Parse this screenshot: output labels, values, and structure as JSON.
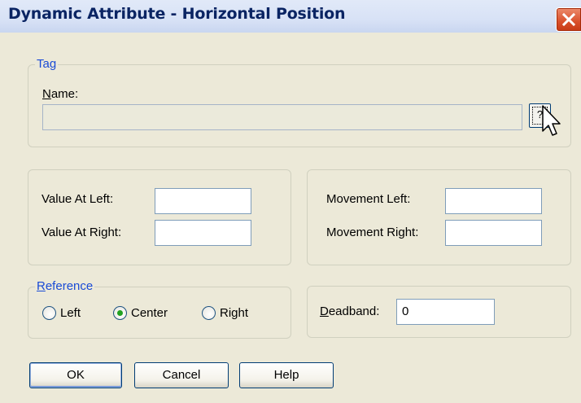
{
  "window": {
    "title": "Dynamic Attribute - Horizontal Position",
    "close_icon": "close-icon"
  },
  "tag": {
    "legend": "Tag",
    "name_label": "Name:",
    "name_value": "",
    "browse_label": "?",
    "cursor_icon": "mouse-pointer-icon"
  },
  "values": {
    "value_at_left_label": "Value At Left:",
    "value_at_left": "",
    "value_at_right_label": "Value At Right:",
    "value_at_right": ""
  },
  "movement": {
    "left_label": "Movement Left:",
    "left_value": "",
    "right_label": "Movement Right:",
    "right_value": ""
  },
  "reference": {
    "legend": "Reference",
    "options": [
      "Left",
      "Center",
      "Right"
    ],
    "selected": "Center"
  },
  "deadband": {
    "label": "Deadband:",
    "value": "0"
  },
  "buttons": {
    "ok": "OK",
    "cancel": "Cancel",
    "help": "Help"
  },
  "colors": {
    "title_text": "#0a2463",
    "legend_text": "#1a4bd6",
    "dialog_bg": "#ece9d8",
    "close_button": "#d9502b",
    "radio_selected": "#21a121"
  }
}
